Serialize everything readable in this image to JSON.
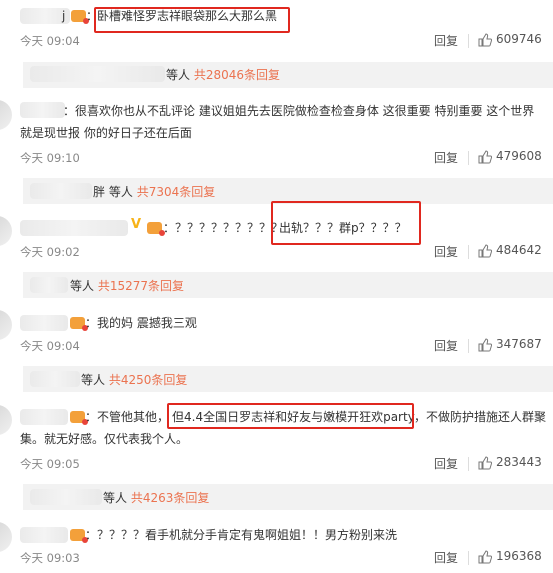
{
  "comments": [
    {
      "colon": "：",
      "text": "卧槽难怪罗志祥眼袋那么大那么黑",
      "time": "今天 09:04",
      "reply": "回复",
      "likes": "609746"
    },
    {
      "colon": "：",
      "text_line1": "很喜欢你也从不乱评论 建议姐姐先去医院做检查检查身体 这很重要 特别重要 这个世界",
      "text_line2": "就是现世报 你的好日子还在后面",
      "time": "今天 09:10",
      "reply": "回复",
      "likes": "479608"
    },
    {
      "colon": "：",
      "text": "？？？？？？？？？",
      "highlight": "出轨？？？群p？？？？",
      "time": "今天 09:02",
      "reply": "回复",
      "likes": "484642"
    },
    {
      "colon": "：",
      "text": "我的妈 震撼我三观",
      "time": "今天 09:04",
      "reply": "回复",
      "likes": "347687"
    },
    {
      "colon": "：",
      "text_pre": "不管他其他，",
      "highlight": "但4.4全国日罗志祥和好友与嫩模开狂欢party",
      "text_post": "，不做防护措施还人群聚",
      "text_line2": "集。就无好感。仅代表我个人。",
      "time": "今天 09:05",
      "reply": "回复",
      "likes": "283443"
    },
    {
      "colon": "：",
      "text": "？？？？看手机就分手肯定有鬼啊姐姐！！男方粉别来洗",
      "time": "今天 09:03",
      "reply": "回复",
      "likes": "196368"
    }
  ],
  "sub_replies": [
    {
      "prefix": "等人",
      "link": "共28046条回复"
    },
    {
      "prefix": "等人",
      "link": "共7304条回复",
      "name_tail": "胖"
    },
    {
      "prefix": "等人",
      "link": "共15277条回复"
    },
    {
      "prefix": "等人",
      "link": "共4250条回复"
    },
    {
      "prefix": "等人",
      "link": "共4263条回复"
    }
  ],
  "colors": {
    "accent": "#eb7350",
    "highlight_border": "#e0281f",
    "vip": "#f3a03a"
  },
  "icons": [
    "thumb-up-icon",
    "vip-badge-icon",
    "verified-v-icon"
  ]
}
